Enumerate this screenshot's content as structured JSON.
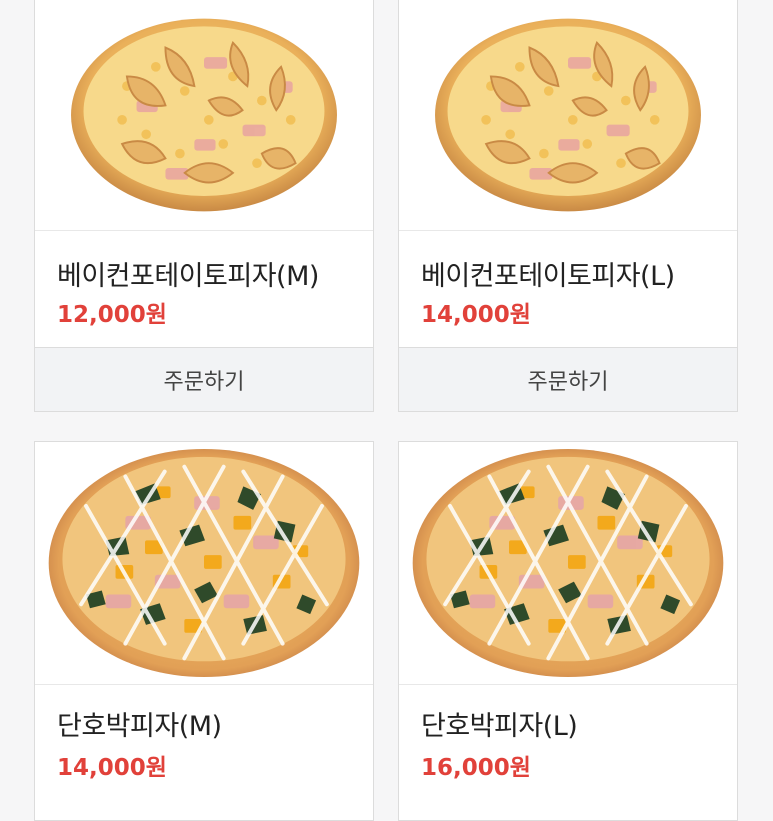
{
  "products": [
    {
      "name": "베이컨포테이토피자(M)",
      "price": "12,000원",
      "order_label": "주문하기",
      "image": "bacon-potato-pizza"
    },
    {
      "name": "베이컨포테이토피자(L)",
      "price": "14,000원",
      "order_label": "주문하기",
      "image": "bacon-potato-pizza"
    },
    {
      "name": "단호박피자(M)",
      "price": "14,000원",
      "image": "sweet-pumpkin-pizza"
    },
    {
      "name": "단호박피자(L)",
      "price": "16,000원",
      "image": "sweet-pumpkin-pizza"
    }
  ],
  "colors": {
    "price": "#e1413a",
    "button_bg": "#f2f3f5",
    "page_bg": "#f6f6f7"
  }
}
